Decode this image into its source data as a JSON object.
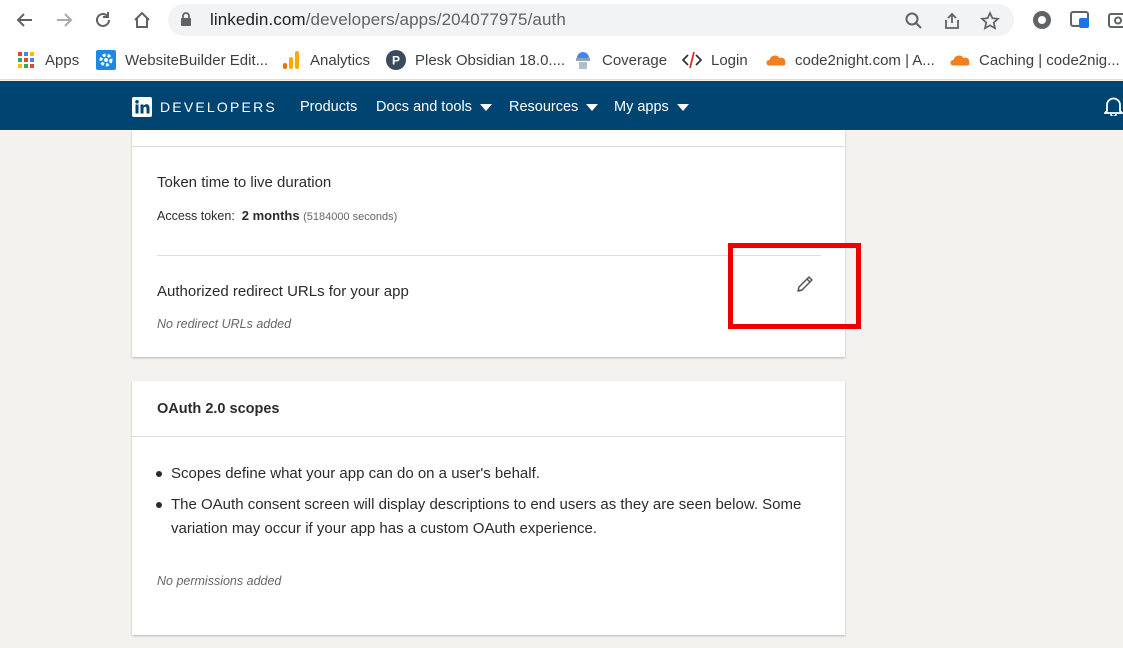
{
  "browser": {
    "url_host": "linkedin.com",
    "url_path": "/developers/apps/204077975/auth",
    "bookmarks": [
      {
        "label": "Apps",
        "icon": "apps-grid-icon"
      },
      {
        "label": "WebsiteBuilder Edit...",
        "icon": "gear-icon"
      },
      {
        "label": "Analytics",
        "icon": "analytics-icon"
      },
      {
        "label": "Plesk Obsidian 18.0....",
        "icon": "plesk-icon"
      },
      {
        "label": "Coverage",
        "icon": "coverage-icon"
      },
      {
        "label": "Login",
        "icon": "code-icon"
      },
      {
        "label": "code2night.com | A...",
        "icon": "cloud-icon"
      },
      {
        "label": "Caching | code2nig...",
        "icon": "cloud-icon"
      }
    ]
  },
  "linkedin_nav": {
    "brand": "DEVELOPERS",
    "items": [
      {
        "label": "Products",
        "has_caret": false
      },
      {
        "label": "Docs and tools",
        "has_caret": true
      },
      {
        "label": "Resources",
        "has_caret": true
      },
      {
        "label": "My apps",
        "has_caret": true
      }
    ]
  },
  "auth_card": {
    "ttl_title": "Token time to live duration",
    "access_label": "Access token:",
    "access_value": "2 months",
    "access_seconds": "(5184000 seconds)",
    "redirect_title": "Authorized redirect URLs for your app",
    "redirect_empty": "No redirect URLs added"
  },
  "scopes_card": {
    "title": "OAuth 2.0 scopes",
    "bullets": [
      "Scopes define what your app can do on a user's behalf.",
      "The OAuth consent screen will display descriptions to end users as they are seen below. Some variation may occur if your app has a custom OAuth experience."
    ],
    "empty": "No permissions added"
  },
  "colors": {
    "nav_bg": "#004471",
    "highlight": "#ee0000",
    "page_bg": "#f3f2ef"
  }
}
